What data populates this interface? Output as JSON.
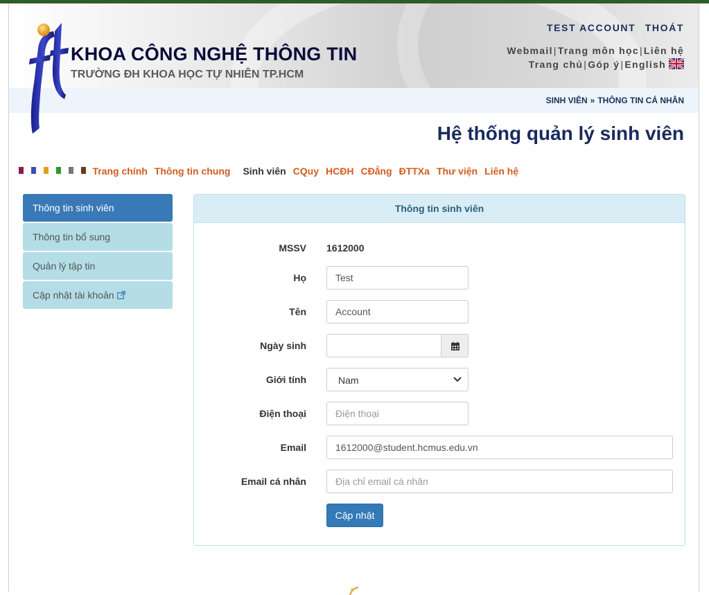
{
  "header": {
    "title": "KHOA CÔNG NGHỆ THÔNG TIN",
    "subtitle": "TRƯỜNG ĐH KHOA HỌC TỰ NHIÊN TP.HCM",
    "user_name": "TEST ACCOUNT",
    "logout": "THOÁT",
    "links_row1": [
      "Webmail",
      "Trang môn học",
      "Liên hệ"
    ],
    "links_row2": [
      "Trang chủ",
      "Góp ý",
      "English"
    ],
    "separator": "|",
    "flag_icon": "uk-flag-icon"
  },
  "breadcrumb": {
    "items": [
      "SINH VIÊN",
      "THÔNG TIN CÁ NHÂN"
    ],
    "separator": "»"
  },
  "page_title": "Hệ thống quản lý sinh viên",
  "main_nav": {
    "swatch_colors": [
      "#8a1a4a",
      "#3a4fb8",
      "#e0a020",
      "#2a9a2a",
      "#777777",
      "#6a3a1a"
    ],
    "items": [
      "Trang chính",
      "Thông tin chung",
      "Sinh viên",
      "CQuy",
      "HCĐH",
      "CĐẳng",
      "ĐTTXa",
      "Thư viện",
      "Liên hệ"
    ],
    "active": "Sinh viên"
  },
  "sidebar": {
    "items": [
      {
        "label": "Thông tin sinh viên"
      },
      {
        "label": "Thông tin bổ sung"
      },
      {
        "label": "Quản lý tập tin"
      },
      {
        "label": "Cập nhật tài khoản"
      }
    ]
  },
  "panel": {
    "title": "Thông tin sinh viên",
    "mssv_label": "MSSV",
    "mssv_value": "1612000",
    "ho_label": "Họ",
    "ho_value": "Test",
    "ten_label": "Tên",
    "ten_value": "Account",
    "ngaysinh_label": "Ngày sinh",
    "ngaysinh_value": "",
    "gioitinh_label": "Giới tính",
    "gioitinh_value": "Nam",
    "dienthoai_label": "Điện thoại",
    "dienthoai_placeholder": "Điện thoại",
    "email_label": "Email",
    "email_value": "1612000@student.hcmus.edu.vn",
    "email_personal_label": "Email cá nhân",
    "email_personal_placeholder": "Địa chỉ email cá nhân",
    "submit_label": "Cập nhật"
  },
  "colors": {
    "accent": "#337ab7",
    "nav_link": "#d35a1f",
    "sidebar_bg": "#b4dde6",
    "panel_head_bg": "#d8edf5"
  }
}
